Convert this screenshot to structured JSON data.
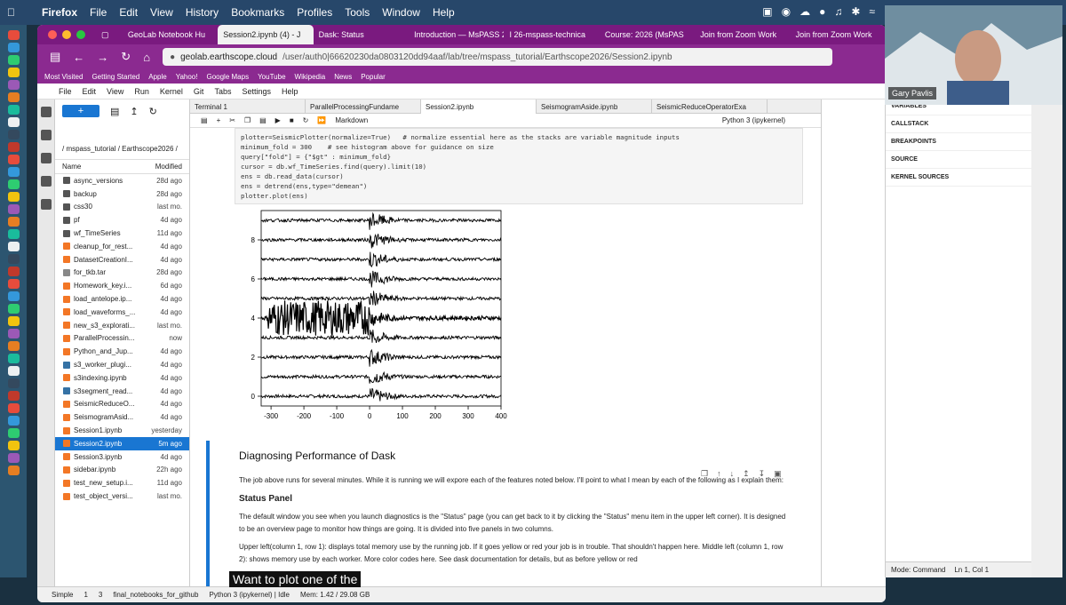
{
  "menubar": {
    "app": "Firefox",
    "items": [
      "File",
      "Edit",
      "View",
      "History",
      "Bookmarks",
      "Profiles",
      "Tools",
      "Window",
      "Help"
    ]
  },
  "firefox_tabs": [
    "GeoLab Notebook Hu",
    "Session2.ipynb (4) - J",
    "Dask: Status",
    "Introduction — MsPASS 2",
    "I 26-mspass-technica",
    "Course: 2026 (MsPAS",
    "Join from Zoom Work",
    "Join from Zoom Work"
  ],
  "url": {
    "host": "geolab.earthscope.cloud",
    "path": "/user/auth0|66620230da0803120dd94aaf/lab/tree/mspass_tutorial/Earthscope2026/Session2.ipynb"
  },
  "bookmarks": [
    "Most Visited",
    "Getting Started",
    "Apple",
    "Yahoo!",
    "Google Maps",
    "YouTube",
    "Wikipedia",
    "News",
    "Popular"
  ],
  "jupyter_menu": [
    "File",
    "Edit",
    "View",
    "Run",
    "Kernel",
    "Git",
    "Tabs",
    "Settings",
    "Help"
  ],
  "filebrowser": {
    "breadcrumb": "/ mspass_tutorial / Earthscope2026 /",
    "col_name": "Name",
    "col_modified": "Modified",
    "files": [
      {
        "name": "async_versions",
        "date": "28d ago",
        "kind": "folder"
      },
      {
        "name": "backup",
        "date": "28d ago",
        "kind": "folder"
      },
      {
        "name": "css30",
        "date": "last mo.",
        "kind": "folder"
      },
      {
        "name": "pf",
        "date": "4d ago",
        "kind": "folder"
      },
      {
        "name": "wf_TimeSeries",
        "date": "11d ago",
        "kind": "folder"
      },
      {
        "name": "cleanup_for_rest...",
        "date": "4d ago",
        "kind": "nb"
      },
      {
        "name": "DatasetCreationI...",
        "date": "4d ago",
        "kind": "nb"
      },
      {
        "name": "for_tkb.tar",
        "date": "28d ago",
        "kind": "file"
      },
      {
        "name": "Homework_key.i...",
        "date": "6d ago",
        "kind": "nb"
      },
      {
        "name": "load_antelope.ip...",
        "date": "4d ago",
        "kind": "nb"
      },
      {
        "name": "load_waveforms_...",
        "date": "4d ago",
        "kind": "nb"
      },
      {
        "name": "new_s3_explorati...",
        "date": "last mo.",
        "kind": "nb"
      },
      {
        "name": "ParallelProcessin...",
        "date": "now",
        "kind": "nb"
      },
      {
        "name": "Python_and_Jup...",
        "date": "4d ago",
        "kind": "nb"
      },
      {
        "name": "s3_worker_plugi...",
        "date": "4d ago",
        "kind": "py"
      },
      {
        "name": "s3indexing.ipynb",
        "date": "4d ago",
        "kind": "nb"
      },
      {
        "name": "s3segment_read...",
        "date": "4d ago",
        "kind": "py"
      },
      {
        "name": "SeismicReduceO...",
        "date": "4d ago",
        "kind": "nb"
      },
      {
        "name": "SeismogramAsid...",
        "date": "4d ago",
        "kind": "nb"
      },
      {
        "name": "Session1.ipynb",
        "date": "yesterday",
        "kind": "nb"
      },
      {
        "name": "Session2.ipynb",
        "date": "5m ago",
        "kind": "nb",
        "selected": true
      },
      {
        "name": "Session3.ipynb",
        "date": "4d ago",
        "kind": "nb"
      },
      {
        "name": "sidebar.ipynb",
        "date": "22h ago",
        "kind": "nb"
      },
      {
        "name": "test_new_setup.i...",
        "date": "11d ago",
        "kind": "nb"
      },
      {
        "name": "test_object_versi...",
        "date": "last mo.",
        "kind": "nb"
      }
    ]
  },
  "doc_tabs": [
    "Terminal 1",
    "ParallelProcessingFundame",
    "Session2.ipynb",
    "SeismogramAside.ipynb",
    "SeismicReduceOperatorExa"
  ],
  "nb_toolbar": {
    "cell_type": "Markdown",
    "kernel": "Python 3 (ipykernel)"
  },
  "code_lines": [
    "plotter=SeismicPlotter(normalize=True)   # normalize essential here as the stacks are variable magnitude inputs",
    "minimum_fold = 300    # see histogram above for guidance on size",
    "query[\"fold\"] = {\"$gt\" : minimum_fold}",
    "cursor = db.wf_TimeSeries.find(query).limit(10)",
    "ens = db.read_data(cursor)",
    "ens = detrend(ens,type=\"demean\")",
    "plotter.plot(ens)"
  ],
  "chart_data": {
    "type": "line",
    "xlim": [
      -330,
      400
    ],
    "ylim": [
      -0.5,
      9.5
    ],
    "xticks": [
      -300,
      -200,
      -100,
      0,
      100,
      200,
      300,
      400
    ],
    "yticks": [
      0,
      2,
      4,
      6,
      8
    ],
    "series_count": 10,
    "grid": false
  },
  "markdown": {
    "title": "Diagnosing Performance of Dask",
    "p1": "The job above runs for several minutes. While it is running we will expore each of the features noted below. I'll point to what I mean by each of the following as I explain them:",
    "h3": "Status Panel",
    "p2": "The default window you see when you launch diagnostics is the \"Status\" page (you can get back to it by clicking the \"Status\" menu item in the upper left corner). It is designed to be an overview page to monitor how things are going. It is divided into five panels in two columns.",
    "p3": "Upper left(column 1, row 1): displays total memory use by the running job. If it goes yellow or red your job is in trouble. That shouldn't happen here. Middle left (column 1, row 2): shows memory use by each worker. More color codes here. See dask documentation for details, but as before yellow or red"
  },
  "debugger": [
    "VARIABLES",
    "CALLSTACK",
    "BREAKPOINTS",
    "SOURCE",
    "KERNEL SOURCES"
  ],
  "statusbar": {
    "mode": "Simple",
    "counts": "1",
    "count2": "3",
    "path": "final_notebooks_for_github",
    "kernel": "Python 3 (ipykernel) | Idle",
    "mem": "Mem: 1.42 / 29.08 GB",
    "cmd": "Mode: Command",
    "pos": "Ln 1, Col 1",
    "file": "Session2.ipynb"
  },
  "video": {
    "name": "Gary Pavlis"
  },
  "caption": "Want to plot one of the"
}
